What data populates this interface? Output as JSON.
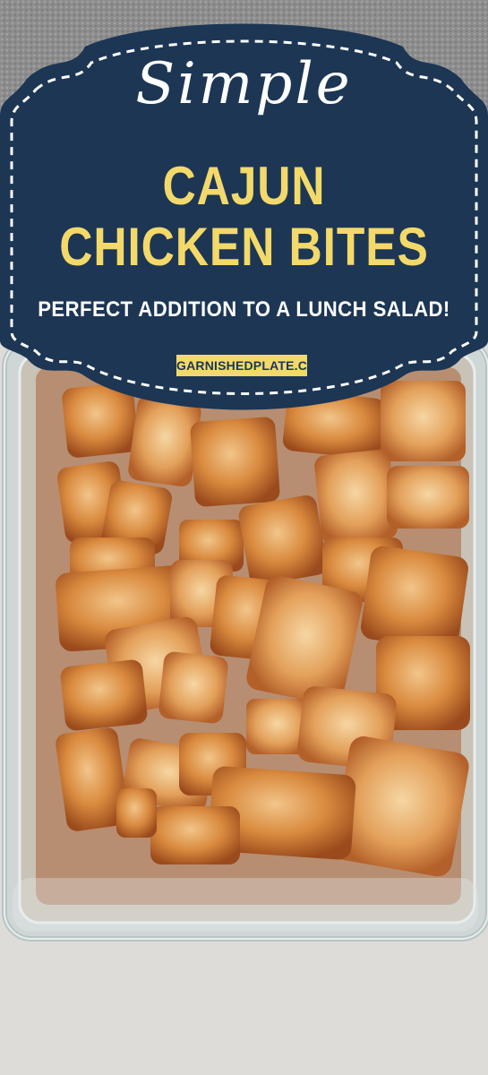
{
  "banner": {
    "script_title": "Simple",
    "headline_line1": "CAJUN",
    "headline_line2": "CHICKEN BITES",
    "tagline": "PERFECT ADDITION TO A LUNCH SALAD!",
    "site": "GARNISHEDPLATE.COM"
  },
  "colors": {
    "banner_bg": "#1c3654",
    "headline": "#f3d96a",
    "site_badge": "#f3d96a",
    "script_text": "#ffffff"
  }
}
